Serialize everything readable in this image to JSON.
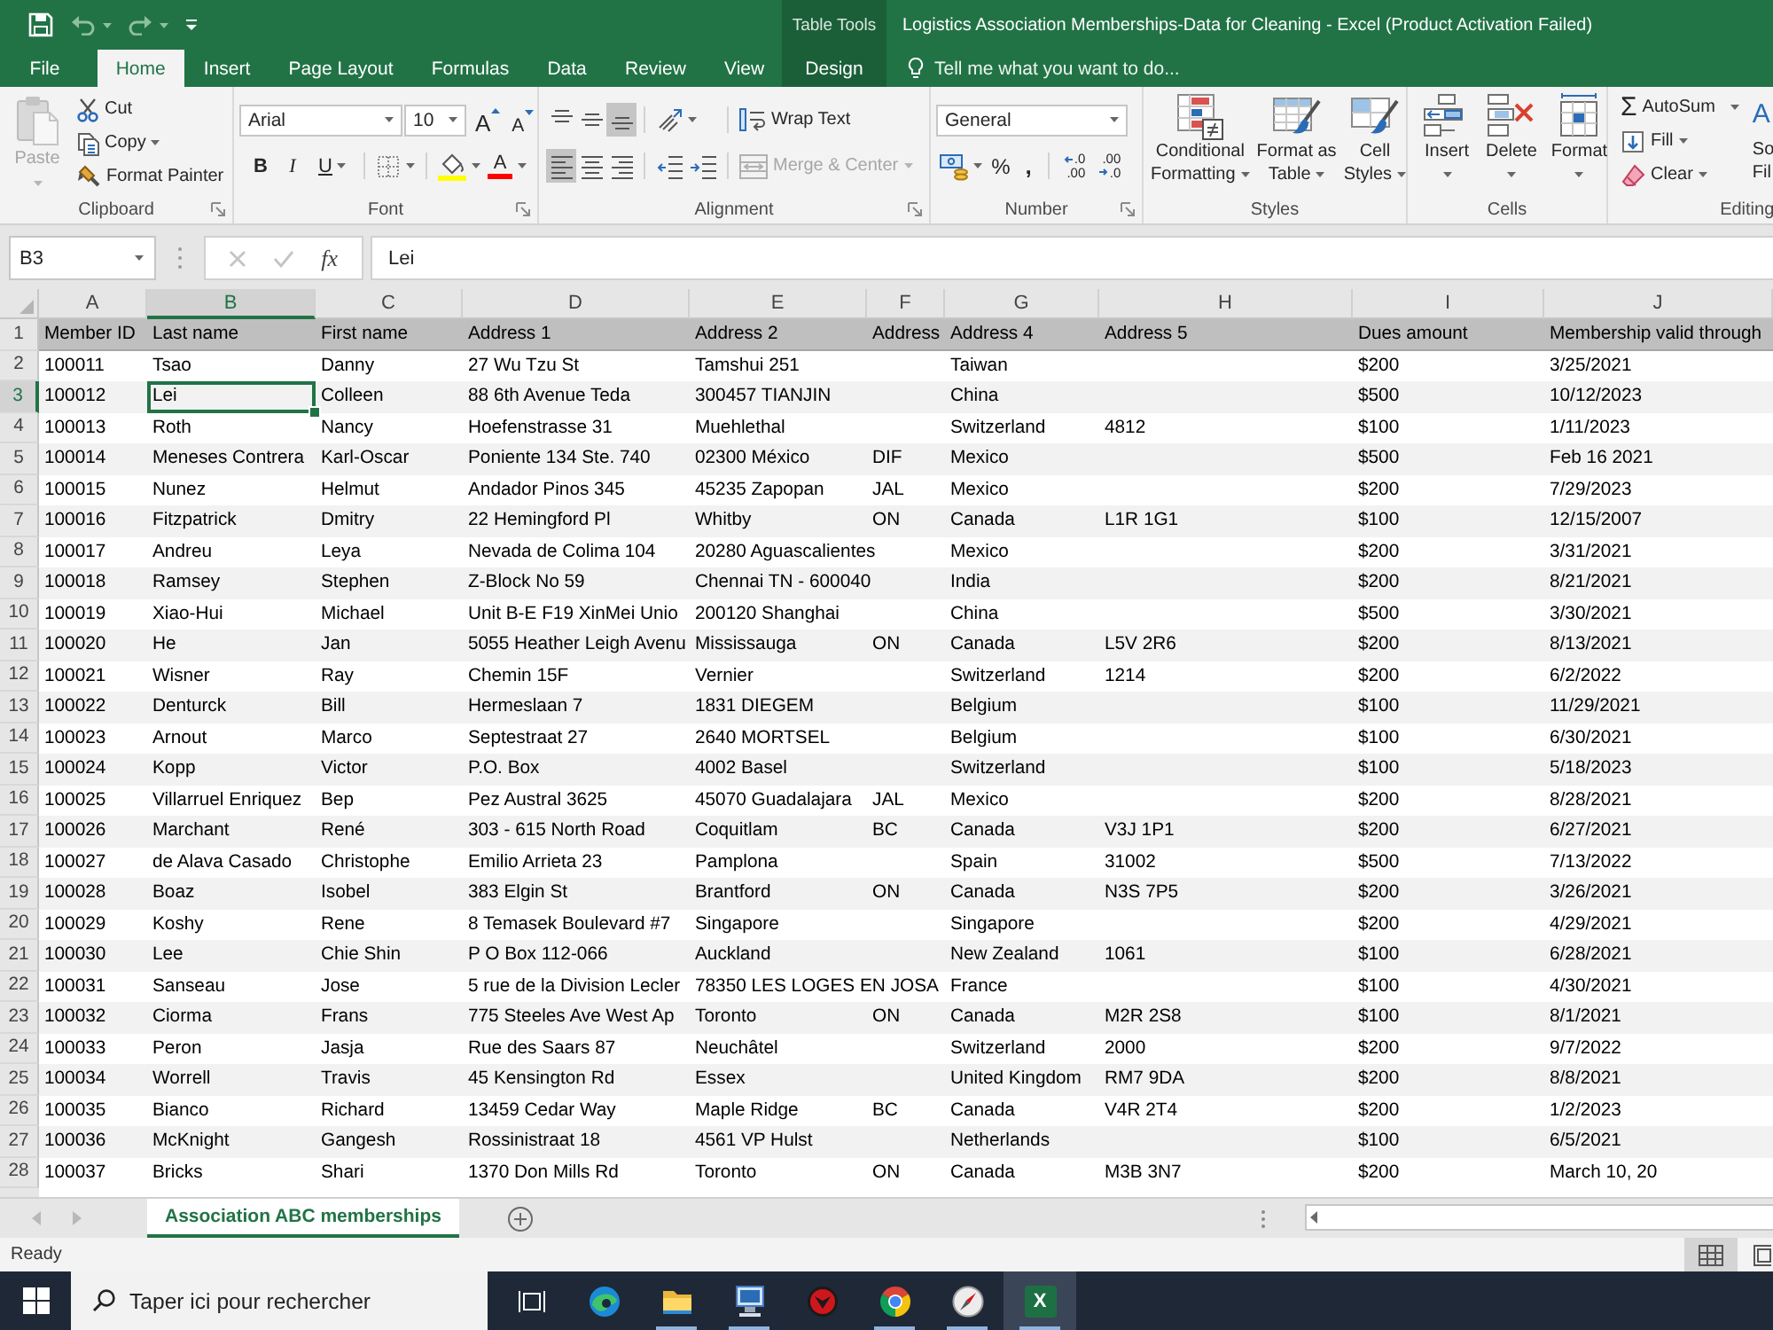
{
  "window": {
    "title": "Logistics Association Memberships-Data for Cleaning - Excel (Product Activation Failed)",
    "context_group": "Table Tools"
  },
  "quick_access": {
    "undo": {
      "disabled": true
    },
    "redo": {
      "disabled": true
    }
  },
  "tabs": [
    {
      "label": "File",
      "kind": "standard",
      "selected": false
    },
    {
      "label": "Home",
      "kind": "standard",
      "selected": true
    },
    {
      "label": "Insert",
      "kind": "standard",
      "selected": false
    },
    {
      "label": "Page Layout",
      "kind": "standard",
      "selected": false
    },
    {
      "label": "Formulas",
      "kind": "standard",
      "selected": false
    },
    {
      "label": "Data",
      "kind": "standard",
      "selected": false
    },
    {
      "label": "Review",
      "kind": "standard",
      "selected": false
    },
    {
      "label": "View",
      "kind": "standard",
      "selected": false
    },
    {
      "label": "Design",
      "kind": "contextual",
      "selected": false
    }
  ],
  "tell_me": {
    "placeholder": "Tell me what you want to do..."
  },
  "ribbon": {
    "clipboard": {
      "label": "Clipboard",
      "paste": {
        "label": "Paste",
        "disabled": true
      },
      "cut": "Cut",
      "copy": "Copy",
      "format_painter": "Format Painter"
    },
    "font": {
      "label": "Font",
      "font_name": "Arial",
      "font_size": "10",
      "grow_font": "A",
      "shrink_font": "A",
      "bold": "B",
      "italic": "I",
      "underline": "U",
      "font_color": "A"
    },
    "alignment": {
      "label": "Alignment",
      "vertical": [
        {
          "selected": false
        },
        {
          "selected": false
        },
        {
          "selected": true
        }
      ],
      "horizontal": [
        {
          "selected": true
        },
        {
          "selected": false
        },
        {
          "selected": false
        }
      ],
      "wrap_text": "Wrap Text",
      "merge_center": {
        "label": "Merge & Center",
        "disabled": true
      }
    },
    "number": {
      "label": "Number",
      "format": "General",
      "percent": "%",
      "comma": ",",
      "increase_decimal": [
        ".0",
        ".00"
      ],
      "decrease_decimal": [
        ".00",
        ".0"
      ]
    },
    "styles": {
      "label": "Styles",
      "buttons": [
        "Conditional Formatting",
        "Format as Table",
        "Cell Styles"
      ]
    },
    "cells": {
      "label": "Cells",
      "buttons": [
        "Insert",
        "Delete",
        "Format"
      ]
    },
    "editing": {
      "label": "Editing",
      "autosum": {
        "symbol": "Σ",
        "label": "AutoSum"
      },
      "fill": "Fill",
      "clear": "Clear",
      "sort_filter": {
        "symbol": "A",
        "label": [
          "So",
          "Fil"
        ]
      }
    }
  },
  "formula_bar": {
    "name_box": "B3",
    "cancel_disabled": true,
    "enter_disabled": true,
    "function_symbol": "fx",
    "formula": "Lei"
  },
  "sheet": {
    "columns": [
      {
        "letter": "A",
        "selected": false
      },
      {
        "letter": "B",
        "selected": true
      },
      {
        "letter": "C",
        "selected": false
      },
      {
        "letter": "D",
        "selected": false
      },
      {
        "letter": "E",
        "selected": false
      },
      {
        "letter": "F",
        "selected": false
      },
      {
        "letter": "G",
        "selected": false
      },
      {
        "letter": "H",
        "selected": false
      },
      {
        "letter": "I",
        "selected": false
      },
      {
        "letter": "J",
        "selected": false
      }
    ],
    "rows": [
      {
        "number": "1",
        "kind": "header",
        "selected": false,
        "cells": {
          "a": "Member ID",
          "b": "Last name",
          "c": "First name",
          "d": "Address 1",
          "e": "Address 2",
          "f": "Address",
          "g": "Address 4",
          "h": "Address 5",
          "i": "Dues amount",
          "j": "Membership valid through"
        }
      },
      {
        "number": "2",
        "kind": "data",
        "selected": false,
        "cells": {
          "a": "100011",
          "b": "Tsao",
          "c": "Danny",
          "d": "27 Wu Tzu St",
          "e": "Tamshui 251",
          "g": "Taiwan",
          "i": "$200",
          "j": "3/25/2021"
        }
      },
      {
        "number": "3",
        "kind": "data",
        "selected": true,
        "cells": {
          "a": "100012",
          "b": "Lei",
          "c": "Colleen",
          "d": "88 6th Avenue Teda",
          "e": "300457 TIANJIN",
          "g": "China",
          "i": "$500",
          "j": "10/12/2023"
        }
      },
      {
        "number": "4",
        "kind": "data",
        "selected": false,
        "cells": {
          "a": "100013",
          "b": "Roth",
          "c": "Nancy",
          "d": "Hoefenstrasse 31",
          "e": "Muehlethal",
          "g": "Switzerland",
          "h": "4812",
          "i": "$100",
          "j": "1/11/2023"
        }
      },
      {
        "number": "5",
        "kind": "data",
        "selected": false,
        "cells": {
          "a": "100014",
          "b": "Meneses Contrera",
          "c": "Karl-Oscar",
          "d": "Poniente 134 Ste. 740",
          "e": "02300 México",
          "f": "DIF",
          "g": "Mexico",
          "i": "$500",
          "j": "Feb 16 2021"
        }
      },
      {
        "number": "6",
        "kind": "data",
        "selected": false,
        "cells": {
          "a": "100015",
          "b": "Nunez",
          "c": "Helmut",
          "d": "Andador Pinos 345",
          "e": "45235 Zapopan",
          "f": "JAL",
          "g": "Mexico",
          "i": "$200",
          "j": "7/29/2023"
        }
      },
      {
        "number": "7",
        "kind": "data",
        "selected": false,
        "cells": {
          "a": "100016",
          "b": "Fitzpatrick",
          "c": "Dmitry",
          "d": "22 Hemingford Pl",
          "e": "Whitby",
          "f": "ON",
          "g": "Canada",
          "h": "L1R 1G1",
          "i": "$100",
          "j": "12/15/2007"
        }
      },
      {
        "number": "8",
        "kind": "data",
        "selected": false,
        "cells": {
          "a": "100017",
          "b": "Andreu",
          "c": "Leya",
          "d": "Nevada de Colima 104",
          "e": "20280 Aguascalientes",
          "g": "Mexico",
          "i": "$200",
          "j": "3/31/2021"
        }
      },
      {
        "number": "9",
        "kind": "data",
        "selected": false,
        "cells": {
          "a": "100018",
          "b": "Ramsey",
          "c": "Stephen",
          "d": "Z-Block No 59",
          "e": "Chennai TN - 600040",
          "g": "India",
          "i": "$200",
          "j": "8/21/2021"
        }
      },
      {
        "number": "10",
        "kind": "data",
        "selected": false,
        "cells": {
          "a": "100019",
          "b": "Xiao-Hui",
          "c": "Michael",
          "d": "Unit B-E F19 XinMei Unio",
          "e": "200120 Shanghai",
          "g": "China",
          "i": "$500",
          "j": "3/30/2021"
        }
      },
      {
        "number": "11",
        "kind": "data",
        "selected": false,
        "cells": {
          "a": "100020",
          "b": "He",
          "c": "Jan",
          "d": "5055 Heather Leigh Avenu",
          "e": "Mississauga",
          "f": "ON",
          "g": "Canada",
          "h": "L5V 2R6",
          "i": "$200",
          "j": "8/13/2021"
        }
      },
      {
        "number": "12",
        "kind": "data",
        "selected": false,
        "cells": {
          "a": "100021",
          "b": "Wisner",
          "c": "Ray",
          "d": "Chemin 15F",
          "e": "Vernier",
          "g": "Switzerland",
          "h": "1214",
          "i": "$200",
          "j": "6/2/2022"
        }
      },
      {
        "number": "13",
        "kind": "data",
        "selected": false,
        "cells": {
          "a": "100022",
          "b": "Denturck",
          "c": "Bill",
          "d": "Hermeslaan 7",
          "e": "1831 DIEGEM",
          "g": "Belgium",
          "i": "$100",
          "j": "11/29/2021"
        }
      },
      {
        "number": "14",
        "kind": "data",
        "selected": false,
        "cells": {
          "a": "100023",
          "b": "Arnout",
          "c": "Marco",
          "d": "Septestraat 27",
          "e": "2640 MORTSEL",
          "g": "Belgium",
          "i": "$100",
          "j": "6/30/2021"
        }
      },
      {
        "number": "15",
        "kind": "data",
        "selected": false,
        "cells": {
          "a": "100024",
          "b": "Kopp",
          "c": "Victor",
          "d": "P.O. Box",
          "e": "4002 Basel",
          "g": "Switzerland",
          "i": "$100",
          "j": "5/18/2023"
        }
      },
      {
        "number": "16",
        "kind": "data",
        "selected": false,
        "cells": {
          "a": "100025",
          "b": "Villarruel Enriquez",
          "c": "Bep",
          "d": "Pez Austral 3625",
          "e": "45070 Guadalajara",
          "f": "JAL",
          "g": "Mexico",
          "i": "$200",
          "j": "8/28/2021"
        }
      },
      {
        "number": "17",
        "kind": "data",
        "selected": false,
        "cells": {
          "a": "100026",
          "b": "Marchant",
          "c": "René",
          "d": "303 - 615 North Road",
          "e": "Coquitlam",
          "f": "BC",
          "g": "Canada",
          "h": "V3J 1P1",
          "i": "$200",
          "j": "6/27/2021"
        }
      },
      {
        "number": "18",
        "kind": "data",
        "selected": false,
        "cells": {
          "a": "100027",
          "b": "de Alava Casado",
          "c": "Christophe",
          "d": "Emilio Arrieta 23",
          "e": "Pamplona",
          "g": "Spain",
          "h": "31002",
          "i": "$500",
          "j": "7/13/2022"
        }
      },
      {
        "number": "19",
        "kind": "data",
        "selected": false,
        "cells": {
          "a": "100028",
          "b": "Boaz",
          "c": "Isobel",
          "d": "383 Elgin St",
          "e": "Brantford",
          "f": "ON",
          "g": "Canada",
          "h": "N3S 7P5",
          "i": "$200",
          "j": "3/26/2021"
        }
      },
      {
        "number": "20",
        "kind": "data",
        "selected": false,
        "cells": {
          "a": "100029",
          "b": "Koshy",
          "c": "Rene",
          "d": "8 Temasek Boulevard #7",
          "e": "Singapore",
          "g": "Singapore",
          "i": "$200",
          "j": "4/29/2021"
        }
      },
      {
        "number": "21",
        "kind": "data",
        "selected": false,
        "cells": {
          "a": "100030",
          "b": "Lee",
          "c": "Chie Shin",
          "d": "P O Box 112-066",
          "e": "Auckland",
          "g": "New Zealand",
          "h": "1061",
          "i": "$100",
          "j": "6/28/2021"
        }
      },
      {
        "number": "22",
        "kind": "data",
        "selected": false,
        "cells": {
          "a": "100031",
          "b": "Sanseau",
          "c": "Jose",
          "d": "5 rue de la Division Lecler",
          "e": "78350 LES LOGES EN JOSA",
          "g": "France",
          "i": "$100",
          "j": "4/30/2021"
        }
      },
      {
        "number": "23",
        "kind": "data",
        "selected": false,
        "cells": {
          "a": "100032",
          "b": "Ciorma",
          "c": "Frans",
          "d": "775 Steeles Ave West Ap",
          "e": "Toronto",
          "f": "ON",
          "g": "Canada",
          "h": "M2R 2S8",
          "i": "$100",
          "j": "8/1/2021"
        }
      },
      {
        "number": "24",
        "kind": "data",
        "selected": false,
        "cells": {
          "a": "100033",
          "b": "Peron",
          "c": "Jasja",
          "d": "Rue des Saars 87",
          "e": "Neuchâtel",
          "g": "Switzerland",
          "h": "2000",
          "i": "$200",
          "j": "9/7/2022"
        }
      },
      {
        "number": "25",
        "kind": "data",
        "selected": false,
        "cells": {
          "a": "100034",
          "b": "Worrell",
          "c": "Travis",
          "d": "45 Kensington Rd",
          "e": "Essex",
          "g": "United Kingdom",
          "h": "RM7 9DA",
          "i": "$200",
          "j": "8/8/2021"
        }
      },
      {
        "number": "26",
        "kind": "data",
        "selected": false,
        "cells": {
          "a": "100035",
          "b": "Bianco",
          "c": "Richard",
          "d": "13459 Cedar Way",
          "e": "Maple Ridge",
          "f": "BC",
          "g": "Canada",
          "h": "V4R 2T4",
          "i": "$200",
          "j": "1/2/2023"
        }
      },
      {
        "number": "27",
        "kind": "data",
        "selected": false,
        "cells": {
          "a": "100036",
          "b": "McKnight",
          "c": "Gangesh",
          "d": "Rossinistraat 18",
          "e": "4561 VP Hulst",
          "g": "Netherlands",
          "i": "$100",
          "j": "6/5/2021"
        }
      },
      {
        "number": "28",
        "kind": "data",
        "selected": false,
        "cells": {
          "a": "100037",
          "b": "Bricks",
          "c": "Shari",
          "d": "1370 Don Mills Rd",
          "e": "Toronto",
          "f": "ON",
          "g": "Canada",
          "h": "M3B 3N7",
          "i": "$200",
          "j": "March 10, 20"
        }
      }
    ]
  },
  "sheet_tabs": [
    {
      "label": "Association ABC memberships",
      "selected": true
    }
  ],
  "status_bar": {
    "text": "Ready",
    "views": [
      {
        "selected": true
      },
      {
        "selected": false
      }
    ]
  },
  "taskbar": {
    "search": {
      "placeholder": "Taper ici pour rechercher"
    },
    "apps": [
      {
        "running": false,
        "selected": false
      },
      {
        "running": true,
        "selected": false
      },
      {
        "running": true,
        "selected": false
      },
      {
        "running": false,
        "selected": false
      },
      {
        "running": true,
        "selected": false
      },
      {
        "running": true,
        "selected": false
      },
      {
        "running": true,
        "selected": true,
        "glyph": "X"
      }
    ]
  }
}
